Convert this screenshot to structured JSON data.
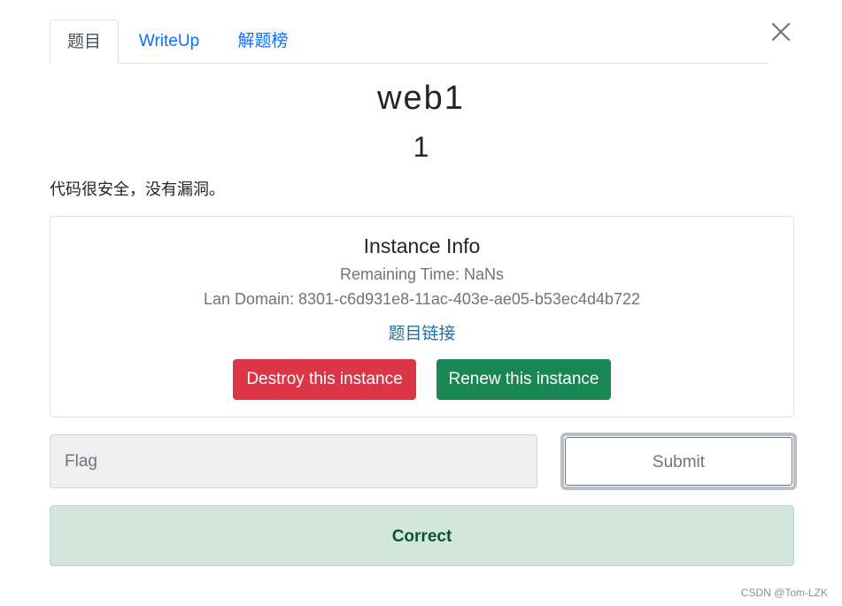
{
  "tabs": [
    {
      "label": "题目",
      "active": true
    },
    {
      "label": "WriteUp",
      "active": false
    },
    {
      "label": "解题榜",
      "active": false
    }
  ],
  "challenge": {
    "name": "web1",
    "points": "1",
    "description": "代码很安全，没有漏洞。"
  },
  "instance": {
    "title": "Instance Info",
    "remaining_time": "Remaining Time: NaNs",
    "lan_domain": "Lan Domain: 8301-c6d931e8-11ac-403e-ae05-b53ec4d4b722",
    "link_label": "题目链接",
    "destroy_label": "Destroy this instance",
    "renew_label": "Renew this instance"
  },
  "flag_form": {
    "placeholder": "Flag",
    "value": "",
    "submit_label": "Submit"
  },
  "result": {
    "message": "Correct",
    "status": "success"
  },
  "watermark": "CSDN @Tom-LZK",
  "icons": {
    "close": "close-icon"
  },
  "colors": {
    "tab_link": "#0d6efd",
    "danger": "#dc3545",
    "success": "#198754",
    "alert_bg": "#d1e7dd",
    "alert_text": "#0f5132"
  }
}
